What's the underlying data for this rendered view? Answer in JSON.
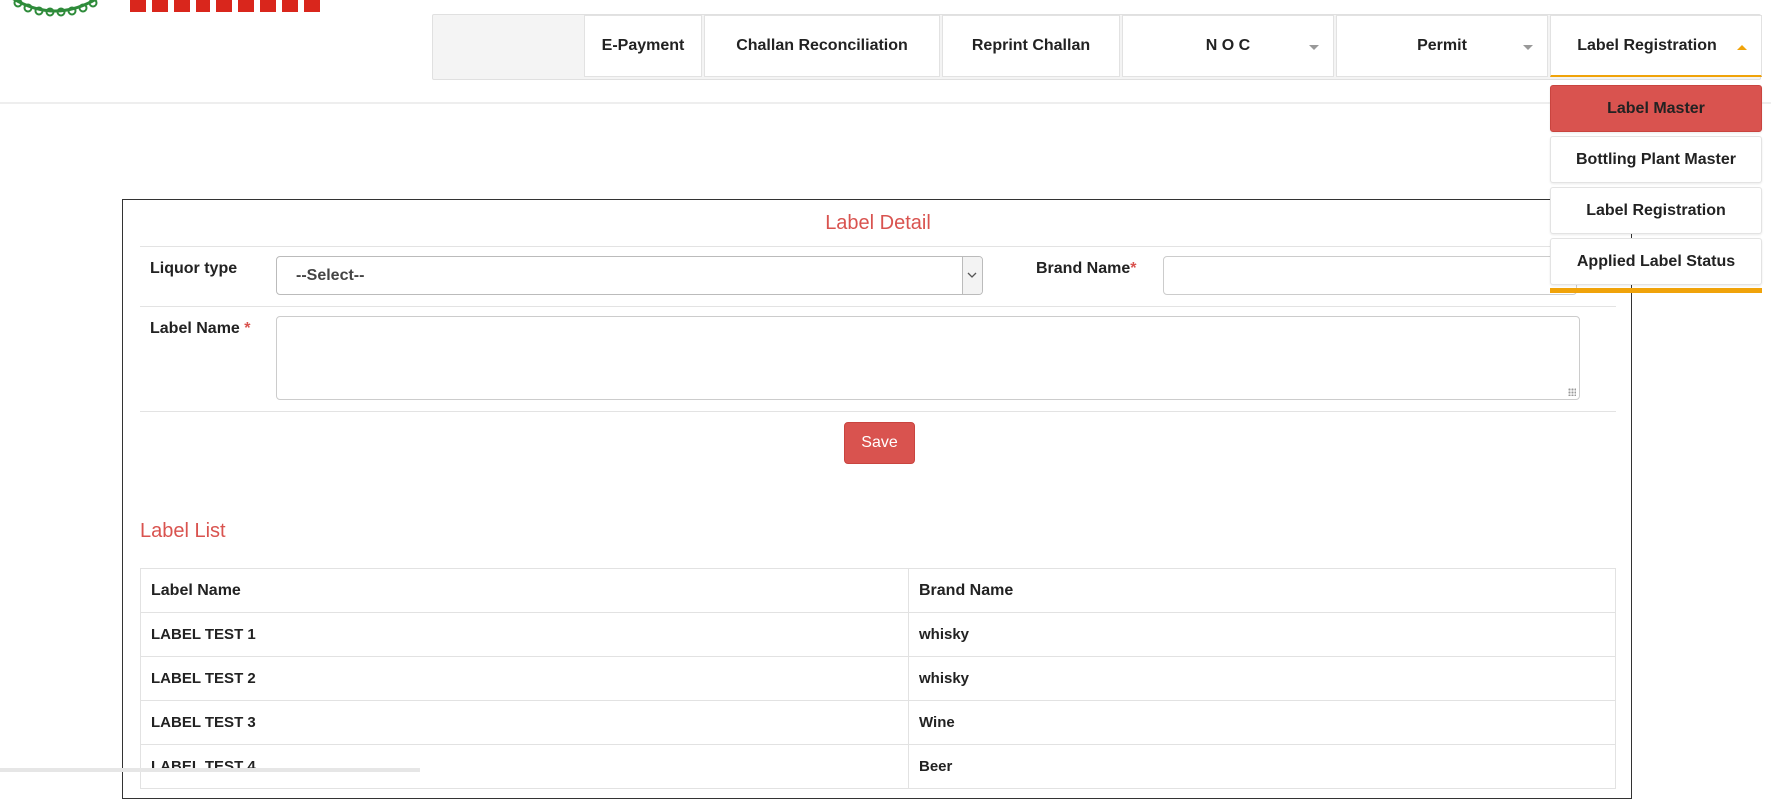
{
  "nav": {
    "items": [
      {
        "label": "E-Payment"
      },
      {
        "label": "Challan Reconciliation"
      },
      {
        "label": "Reprint Challan"
      },
      {
        "label": "N O C"
      },
      {
        "label": "Permit"
      },
      {
        "label": "Label Registration"
      }
    ],
    "dropdown": [
      {
        "label": "Label Master"
      },
      {
        "label": "Bottling Plant Master"
      },
      {
        "label": "Label Registration"
      },
      {
        "label": "Applied Label Status"
      }
    ]
  },
  "form": {
    "title": "Label Detail",
    "liquor_type_label": "Liquor type",
    "liquor_type_value": "--Select--",
    "brand_name_label": "Brand Name",
    "label_name_label": "Label Name ",
    "required_mark": "*",
    "save_label": "Save"
  },
  "list": {
    "title": "Label List",
    "columns": [
      "Label Name",
      "Brand Name"
    ],
    "rows": [
      [
        "LABEL TEST 1",
        "whisky"
      ],
      [
        "LABEL TEST 2",
        "whisky"
      ],
      [
        "LABEL TEST 3",
        "Wine"
      ],
      [
        "LABEL TEST 4",
        "Beer"
      ]
    ]
  },
  "icons": {
    "logo": "emblem-logo-icon",
    "caret": "caret-down-icon",
    "caret_open": "caret-up-icon",
    "select_arrow": "chevron-down-icon",
    "resize": "resize-grip-icon"
  },
  "colors": {
    "accent": "#d9534f",
    "nav_highlight": "#f0a30a",
    "header_title": "#d9261c"
  }
}
